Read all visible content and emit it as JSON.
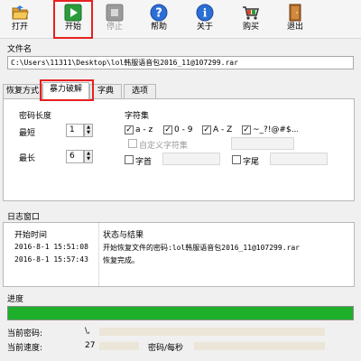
{
  "toolbar": {
    "open": "打开",
    "start": "开始",
    "stop": "停止",
    "help": "帮助",
    "about": "关于",
    "buy": "购买",
    "exit": "退出"
  },
  "file": {
    "label": "文件名",
    "path": "C:\\Users\\11311\\Desktop\\lol韩服语音包2016_11@107299.rar"
  },
  "tabs": [
    "恢复方式",
    "暴力破解",
    "字典",
    "选项"
  ],
  "brute": {
    "pwd_length_label": "密码长度",
    "min_label": "最短",
    "min_value": "1",
    "max_label": "最长",
    "max_value": "6",
    "charset_label": "字符集",
    "charset": [
      {
        "label": "a - z",
        "checked": true
      },
      {
        "label": "0 - 9",
        "checked": true
      },
      {
        "label": "A - Z",
        "checked": true
      },
      {
        "label": "~_?!@#$...",
        "checked": true
      }
    ],
    "custom_label": "自定义字符集",
    "prefix_label": "字首",
    "suffix_label": "字尾"
  },
  "log": {
    "title": "日志窗口",
    "col_time": "开始时间",
    "col_status": "状态与结果",
    "rows": [
      {
        "time": "2016-8-1 15:51:08",
        "msg": "开始恢复文件的密码:lol韩服语音包2016_11@107299.rar"
      },
      {
        "time": "2016-8-1 15:57:43",
        "msg": "恢复完成。"
      }
    ]
  },
  "progress": {
    "label": "进度",
    "fraction": 1.0
  },
  "status": {
    "current_pwd_label": "当前密码:",
    "current_pwd_value": "\\,",
    "current_speed_label": "当前速度:",
    "current_speed_value": "27",
    "speed_unit": "密码/每秒"
  },
  "colors": {
    "highlight": "#e82020",
    "progress": "#1eaf2b"
  }
}
